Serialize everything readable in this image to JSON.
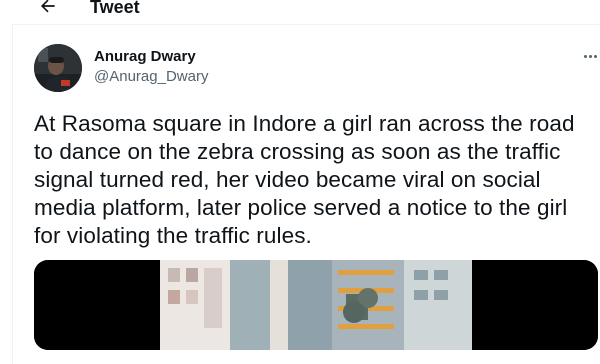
{
  "header": {
    "title": "Tweet",
    "back_icon": "arrow-left-icon"
  },
  "tweet": {
    "author_name": "Anurag Dwary",
    "author_handle": "@Anurag_Dwary",
    "more_icon": "more-horizontal-icon",
    "text": "At Rasoma square in Indore a girl ran across the road to dance on the zebra crossing as soon as the traffic signal turned red, her video became viral on social media platform, later police served a notice to the girl for violating the traffic rules."
  },
  "colors": {
    "text_primary": "#0f1419",
    "text_secondary": "#536471",
    "border": "#eff3f4",
    "media_background": "#000000"
  }
}
